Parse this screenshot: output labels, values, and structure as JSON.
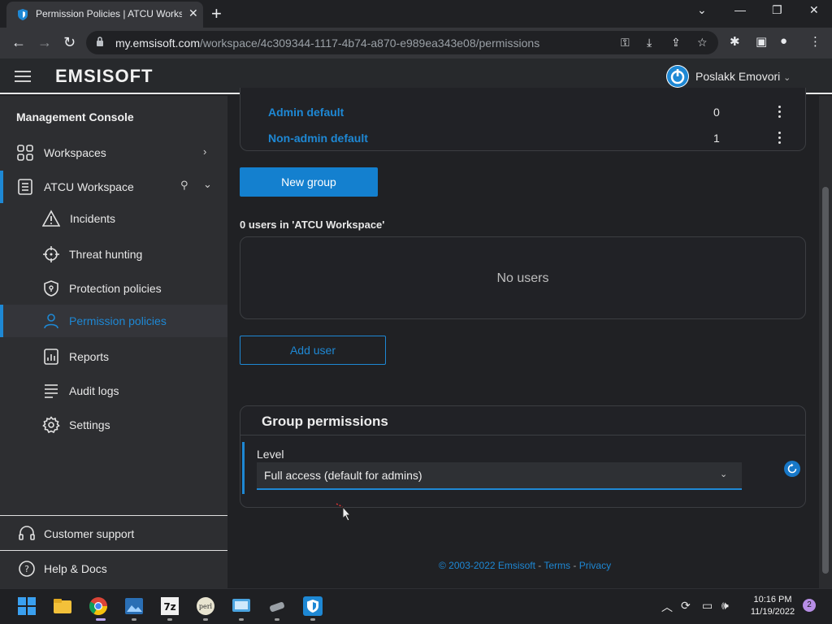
{
  "browser": {
    "tab_title": "Permission Policies | ATCU Workspace",
    "url_host": "my.emsisoft.com",
    "url_path": "/workspace/4c309344-1117-4b74-a870-e989ea343e08/permissions"
  },
  "header": {
    "logo": "EMSISOFT",
    "user_name": "Poslakk Emovori"
  },
  "sidebar": {
    "heading": "Management Console",
    "items": [
      {
        "label": "Workspaces"
      },
      {
        "label": "ATCU Workspace"
      },
      {
        "label": "Incidents"
      },
      {
        "label": "Threat hunting"
      },
      {
        "label": "Protection policies"
      },
      {
        "label": "Permission policies"
      },
      {
        "label": "Reports"
      },
      {
        "label": "Audit logs"
      },
      {
        "label": "Settings"
      }
    ],
    "support": "Customer support",
    "help": "Help & Docs"
  },
  "groups": [
    {
      "name": "Admin default",
      "count": "0"
    },
    {
      "name": "Non-admin default",
      "count": "1"
    }
  ],
  "actions": {
    "new_group": "New group",
    "add_user": "Add user"
  },
  "users": {
    "count_label": "0 users in 'ATCU Workspace'",
    "empty": "No users"
  },
  "group_permissions": {
    "title": "Group permissions",
    "level_label": "Level",
    "level_value": "Full access (default for admins)"
  },
  "footer": {
    "copyright": "© 2003-2022 Emsisoft",
    "sep": "-",
    "terms": "Terms",
    "privacy": "Privacy"
  },
  "taskbar": {
    "time": "10:16 PM",
    "date": "11/19/2022",
    "notifications": "2"
  },
  "colors": {
    "accent": "#1e88d4",
    "sidebar_bg": "#2d2e31",
    "main_bg": "#202124"
  }
}
